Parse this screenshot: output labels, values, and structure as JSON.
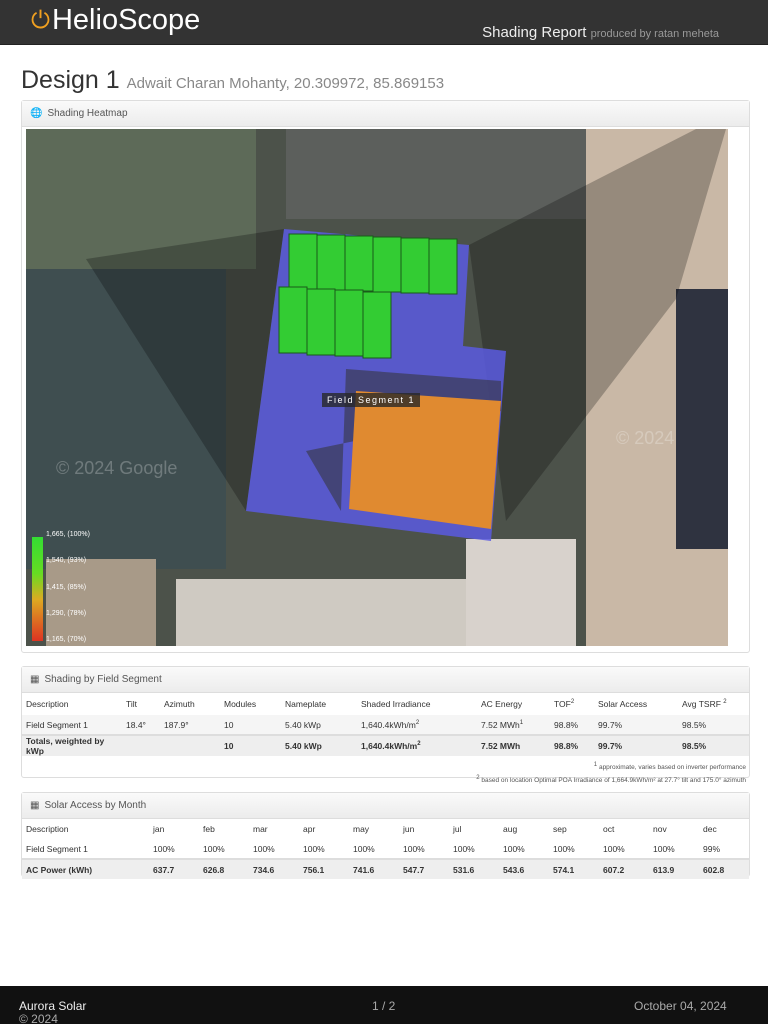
{
  "header": {
    "logo": "HelioScope",
    "report_title": "Shading Report",
    "produced_by": "produced by ratan meheta"
  },
  "design": {
    "name": "Design 1",
    "subtitle": "Adwait Charan Mohanty, 20.309972, 85.869153"
  },
  "heatmap": {
    "title": "Shading Heatmap",
    "segment_label": "Field Segment 1",
    "watermark": "© 2024 Google",
    "legend": [
      "1,665, (100%)",
      "1,540, (93%)",
      "1,415, (85%)",
      "1,290, (78%)",
      "1,165, (70%)"
    ],
    "colors": {
      "roof": "#5a5ae0",
      "module_good": "#33cc33",
      "module_shaded": "#e08a30"
    }
  },
  "segments": {
    "title": "Shading by Field Segment",
    "headers": [
      "Description",
      "Tilt",
      "Azimuth",
      "Modules",
      "Nameplate",
      "Shaded Irradiance",
      "AC Energy",
      "TOF",
      "Solar Access",
      "Avg TSRF"
    ],
    "row": [
      "Field Segment 1",
      "18.4°",
      "187.9°",
      "10",
      "5.40 kWp",
      "1,640.4kWh/m",
      "7.52 MWh",
      "98.8%",
      "99.7%",
      "98.5%"
    ],
    "totals": [
      "Totals, weighted by kWp",
      "",
      "",
      "10",
      "5.40 kWp",
      "1,640.4kWh/m",
      "7.52 MWh",
      "98.8%",
      "99.7%",
      "98.5%"
    ],
    "note1": "approximate, varies based on inverter performance",
    "note2": "based on location Optimal POA Irradiance of 1,664.9kWh/m² at 27.7° tilt and 175.0° azimuth"
  },
  "months": {
    "title": "Solar Access by Month",
    "headers": [
      "Description",
      "jan",
      "feb",
      "mar",
      "apr",
      "may",
      "jun",
      "jul",
      "aug",
      "sep",
      "oct",
      "nov",
      "dec"
    ],
    "access": [
      "Field Segment 1",
      "100%",
      "100%",
      "100%",
      "100%",
      "100%",
      "100%",
      "100%",
      "100%",
      "100%",
      "100%",
      "100%",
      "99%"
    ],
    "power": [
      "AC Power (kWh)",
      "637.7",
      "626.8",
      "734.6",
      "756.1",
      "741.6",
      "547.7",
      "531.6",
      "543.6",
      "574.1",
      "607.2",
      "613.9",
      "602.8"
    ]
  },
  "footer": {
    "copyright": "© 2024",
    "company": "Aurora Solar",
    "page": "1 / 2",
    "date": "October 04, 2024"
  }
}
